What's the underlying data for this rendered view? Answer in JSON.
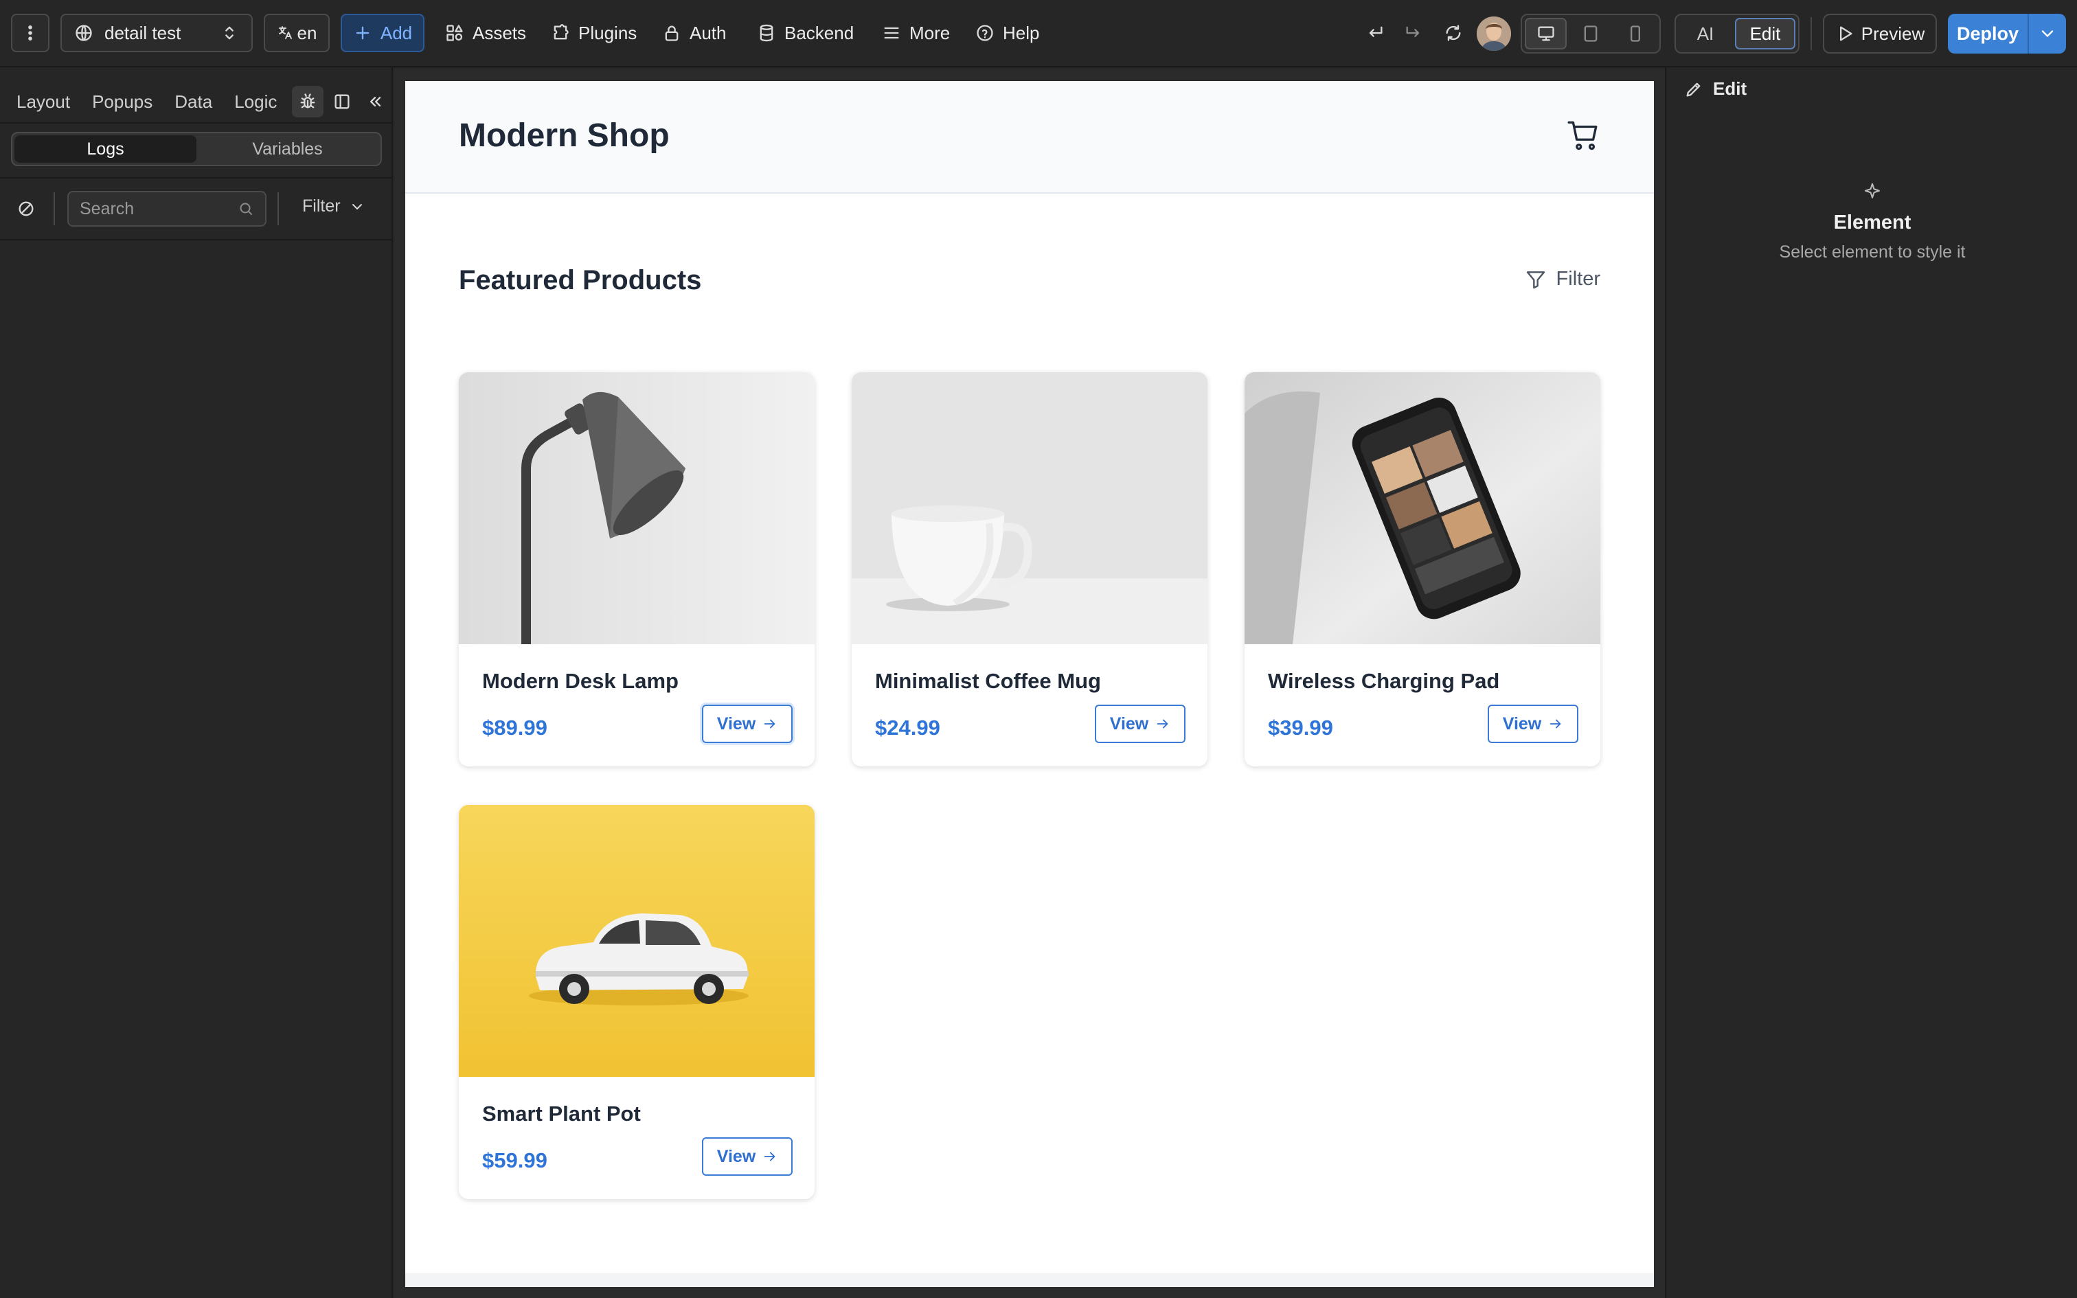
{
  "topbar": {
    "project_name": "detail test",
    "language": "en",
    "add_label": "Add",
    "assets_label": "Assets",
    "plugins_label": "Plugins",
    "auth_label": "Auth",
    "backend_label": "Backend",
    "more_label": "More",
    "help_label": "Help",
    "mode_ai": "AI",
    "mode_edit": "Edit",
    "preview_label": "Preview",
    "deploy_label": "Deploy"
  },
  "left_panel": {
    "tabs": [
      "Layout",
      "Popups",
      "Data",
      "Logic"
    ],
    "seg_logs": "Logs",
    "seg_variables": "Variables",
    "search_placeholder": "Search",
    "filter_label": "Filter"
  },
  "page": {
    "shop_title": "Modern Shop",
    "section_title": "Featured Products",
    "filter_label": "Filter",
    "view_label": "View",
    "products": [
      {
        "name": "Modern Desk Lamp",
        "price": "$89.99"
      },
      {
        "name": "Minimalist Coffee Mug",
        "price": "$24.99"
      },
      {
        "name": "Wireless Charging Pad",
        "price": "$39.99"
      },
      {
        "name": "Smart Plant Pot",
        "price": "$59.99"
      }
    ]
  },
  "right_panel": {
    "edit_label": "Edit",
    "empty_title": "Element",
    "empty_subtitle": "Select element to style it"
  },
  "colors": {
    "accent": "#3b82d6",
    "price": "#2f74d8",
    "panel_bg": "#262626"
  }
}
